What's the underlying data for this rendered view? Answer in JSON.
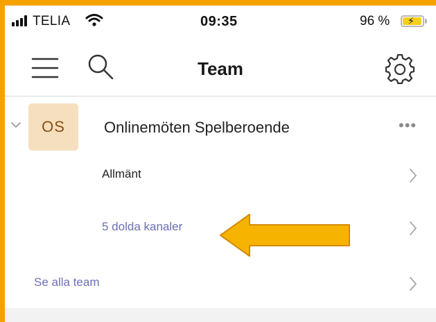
{
  "status_bar": {
    "carrier": "TELIA",
    "time": "09:35",
    "battery_percent": "96 %",
    "battery_level": 0.96,
    "battery_color": "#f5cf1b",
    "icons": [
      "signal-icon",
      "wifi-icon",
      "battery-icon",
      "charging-bolt-icon"
    ]
  },
  "nav": {
    "title": "Team",
    "icons": [
      "hamburger-menu-icon",
      "search-icon",
      "gear-icon"
    ]
  },
  "team": {
    "avatar_initials": "OS",
    "avatar_bg": "#f6dfbf",
    "name": "Onlinemöten Spelberoende",
    "more_label": "•••",
    "channels": [
      {
        "label": "Allmänt"
      },
      {
        "label": "5 dolda kanaler"
      }
    ]
  },
  "see_all": {
    "label": "Se alla team"
  },
  "colors": {
    "frame": "#f5a100",
    "link": "#6c6fb3",
    "arrow": "#f6b400"
  }
}
